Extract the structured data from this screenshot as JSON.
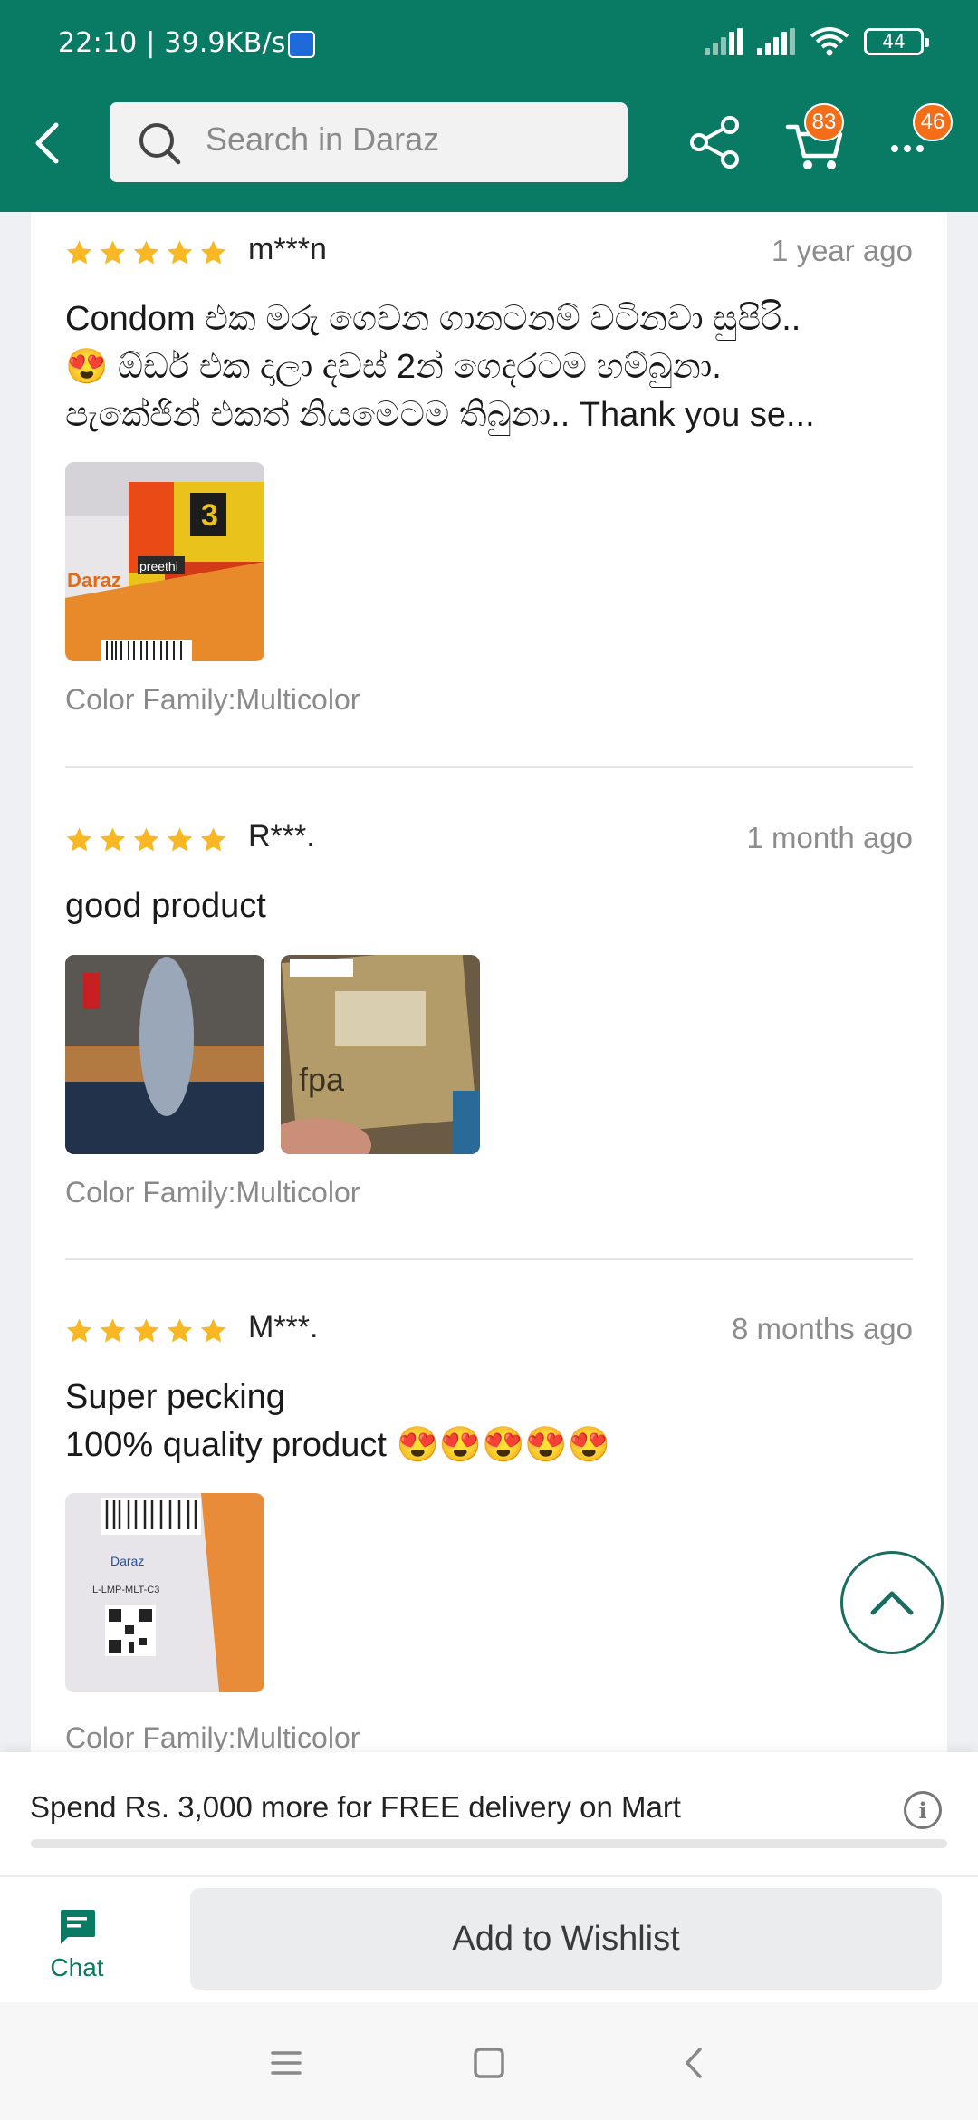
{
  "status_bar": {
    "time_speed": "22:10 | 39.9KB/s",
    "battery": "44"
  },
  "header": {
    "search_placeholder": "Search in Daraz",
    "cart_badge": "83",
    "more_badge": "46"
  },
  "reviews": [
    {
      "stars": 5,
      "reviewer": "m***n",
      "date": "1 year ago",
      "text": "Condom එක මරු ගෙවන ගානටනම් වටිනවා සුපිරි..\n😍 ඕඩර් එක දාලා දවස් 2න් ගෙදරටම හම්බුනා.\nපැකේජින් එකත් නියමෙටම තිබුනා.. Thank you se...",
      "sku": "Color Family:Multicolor",
      "images": 1
    },
    {
      "stars": 5,
      "reviewer": "R***.",
      "date": "1 month ago",
      "text": "good product",
      "sku": "Color Family:Multicolor",
      "images": 2
    },
    {
      "stars": 5,
      "reviewer": "M***.",
      "date": "8 months ago",
      "text": "Super pecking\n100% quality product 😍😍😍😍😍",
      "sku": "Color Family:Multicolor",
      "images": 1
    }
  ],
  "delivery": {
    "text": "Spend Rs. 3,000 more for FREE delivery on Mart",
    "progress": 0.0
  },
  "actions": {
    "chat_label": "Chat",
    "wishlist_label": "Add to Wishlist"
  },
  "icons": [
    "back-arrow-icon",
    "search-icon",
    "share-icon",
    "cart-icon",
    "more-icon",
    "star-icon",
    "scroll-top-icon",
    "info-icon",
    "chat-icon",
    "menu-icon",
    "home-icon",
    "back-nav-icon"
  ],
  "colors": {
    "brand_green": "#097a63",
    "badge_orange": "#f46d18",
    "star_yellow": "#f9b823"
  }
}
